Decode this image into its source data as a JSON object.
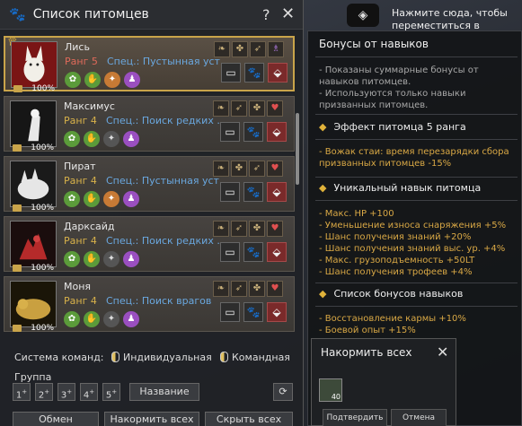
{
  "window": {
    "title": "Список питомцев",
    "help": "?",
    "close": "✕"
  },
  "hint": {
    "text": "Нажмите сюда, чтобы переместиться в"
  },
  "pets": [
    {
      "name": "Лись",
      "rank": "Ранг 5",
      "spec": "Спец.: Пустынная уст...",
      "hunger": "100%",
      "selected": true
    },
    {
      "name": "Максимус",
      "rank": "Ранг 4",
      "spec": "Спец.: Поиск редких ...",
      "hunger": "100%",
      "selected": false
    },
    {
      "name": "Пират",
      "rank": "Ранг 4",
      "spec": "Спец.: Пустынная уст...",
      "hunger": "100%",
      "selected": false
    },
    {
      "name": "Дарксайд",
      "rank": "Ранг 4",
      "spec": "Спец.: Поиск редких ...",
      "hunger": "100%",
      "selected": false
    },
    {
      "name": "Моня",
      "rank": "Ранг 4",
      "spec": "Спец.: Поиск врагов",
      "hunger": "100%",
      "selected": false
    }
  ],
  "bottom": {
    "command_system": "Система команд:",
    "individual": "Индивидуальная",
    "team": "Командная",
    "group": "Группа",
    "groups": [
      "1",
      "2",
      "3",
      "4",
      "5"
    ],
    "name_button": "Название",
    "exchange": "Обмен",
    "feed_all": "Накормить всех",
    "hide_all": "Скрыть всех"
  },
  "bonus_panel": {
    "title": "Бонусы от навыков",
    "note1": "- Показаны суммарные бонусы от навыков питомцев.",
    "note2": "- Используются только навыки призванных питомцев.",
    "rank5_title": "Эффект питомца 5 ранга",
    "rank5_line": "- Вожак стаи: время перезарядки сбора призванных питомцев -15%",
    "unique_title": "Уникальный навык питомца",
    "unique_lines": [
      "- Макс. HP +100",
      "- Уменьшение износа снаряжения +5%",
      "- Шанс получения знаний +20%",
      "- Шанс получения знаний выс. ур. +4%",
      "- Макс. грузоподъемность +50LT",
      "- Шанс получения трофеев +4%"
    ],
    "list_title": "Список бонусов навыков",
    "list_lines": [
      "- Восстановление кармы +10%",
      "- Боевой опыт +15%"
    ]
  },
  "feed_dialog": {
    "title": "Накормить всех",
    "item_count": "40",
    "confirm": "Подтвердить",
    "cancel": "Отмена"
  }
}
